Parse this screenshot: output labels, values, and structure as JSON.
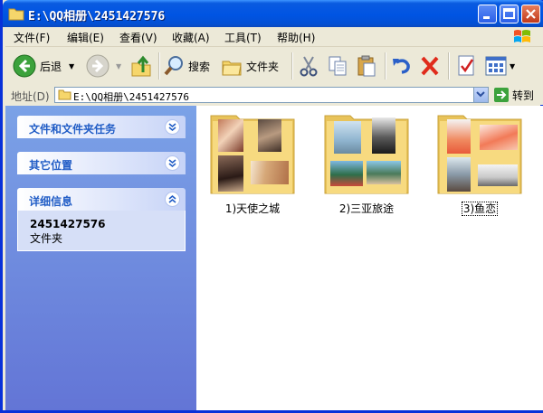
{
  "window": {
    "title": "E:\\QQ相册\\2451427576"
  },
  "menu": [
    "文件(F)",
    "编辑(E)",
    "查看(V)",
    "收藏(A)",
    "工具(T)",
    "帮助(H)"
  ],
  "toolbar": {
    "back": "后退",
    "search": "搜索",
    "folders": "文件夹"
  },
  "address": {
    "label": "地址(D)",
    "path": "E:\\QQ相册\\2451427576",
    "go": "转到"
  },
  "sidebar": {
    "tasks_title": "文件和文件夹任务",
    "places_title": "其它位置",
    "details_title": "详细信息",
    "details_name": "2451427576",
    "details_type": "文件夹"
  },
  "folders": [
    {
      "label": "1)天使之城"
    },
    {
      "label": "2)三亚旅途"
    },
    {
      "label": "3)鱼恋"
    }
  ],
  "colors": {
    "titlebar": "#0054E3",
    "sidebar": "#6F8DDE",
    "accent": "#215DC6"
  }
}
